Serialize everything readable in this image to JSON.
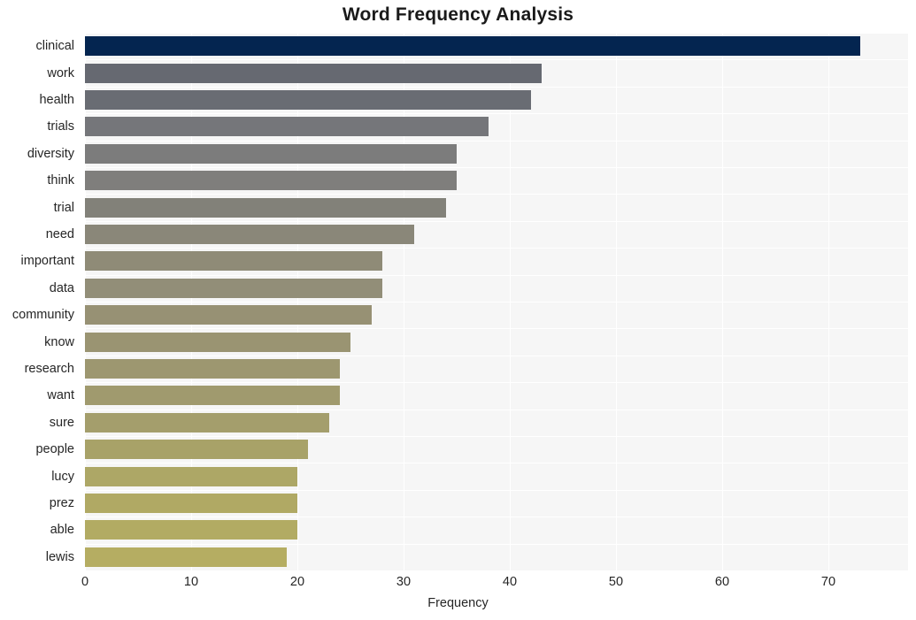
{
  "chart_data": {
    "type": "bar",
    "orientation": "horizontal",
    "title": "Word Frequency Analysis",
    "xlabel": "Frequency",
    "ylabel": "",
    "categories": [
      "clinical",
      "work",
      "health",
      "trials",
      "diversity",
      "think",
      "trial",
      "need",
      "important",
      "data",
      "community",
      "know",
      "research",
      "want",
      "sure",
      "people",
      "lucy",
      "prez",
      "able",
      "lewis"
    ],
    "values": [
      73,
      43,
      42,
      38,
      35,
      35,
      34,
      31,
      28,
      28,
      27,
      25,
      24,
      24,
      23,
      21,
      20,
      20,
      20,
      19
    ],
    "bar_colors": [
      "#042550",
      "#666971",
      "#696c73",
      "#75767a",
      "#7c7c7c",
      "#7f7e7c",
      "#828179",
      "#8a8779",
      "#8f8b77",
      "#928e78",
      "#979174",
      "#9a9472",
      "#9d9770",
      "#a09a6e",
      "#a49e6c",
      "#a8a268",
      "#ada766",
      "#b0a964",
      "#b2ab63",
      "#b5ad62"
    ],
    "xticks": [
      0,
      10,
      20,
      30,
      40,
      50,
      60,
      70
    ],
    "xlim": [
      0,
      77.5
    ],
    "grid": true,
    "legend": "none",
    "plot_background": "#f6f6f6",
    "gridline_color": "#ffffff",
    "text_color": "#262626"
  }
}
